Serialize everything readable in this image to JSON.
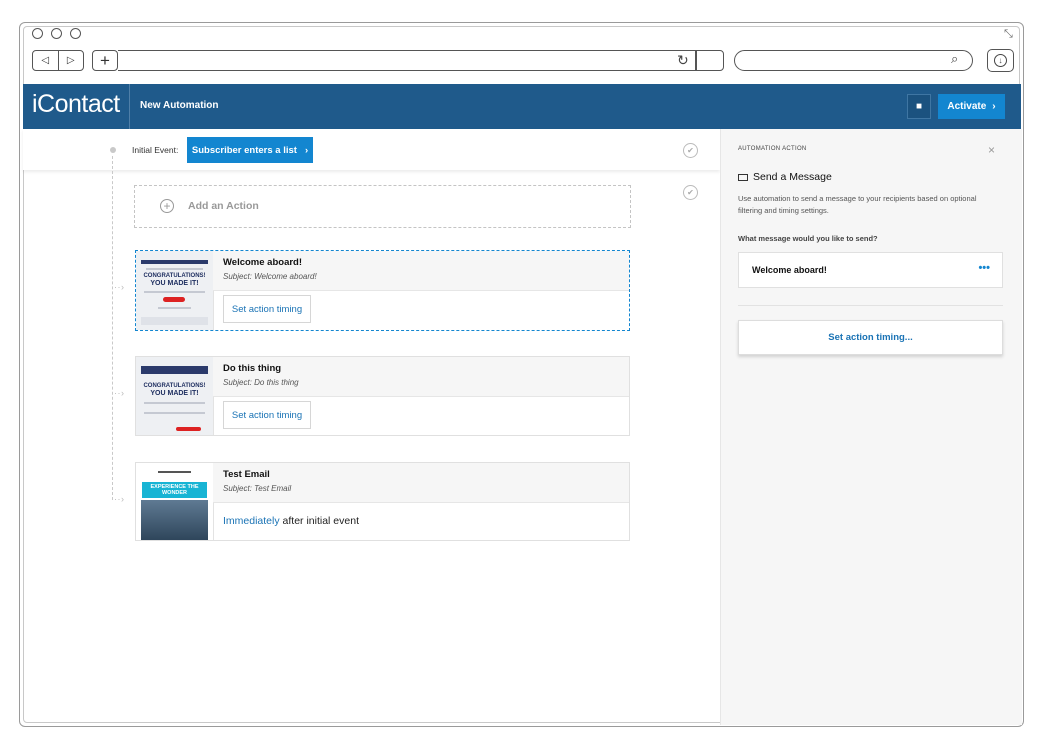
{
  "browser": {
    "back_glyph": "◁",
    "forward_glyph": "▷",
    "new_tab_glyph": "+",
    "reload_glyph": "↻",
    "search_glyph": "⌕",
    "download_glyph": "↓",
    "expand_glyph": "⤡",
    "icons": [
      "back-icon",
      "forward-icon",
      "plus-icon",
      "reload-icon",
      "search-icon",
      "download-icon",
      "expand-icon"
    ]
  },
  "header": {
    "logo": "iContact",
    "title": "New Automation",
    "save_glyph": "■",
    "activate_label": "Activate",
    "activate_chevron": "›",
    "brand_color": "#1f5a8b",
    "accent_color": "#1386d0"
  },
  "workflow": {
    "initial_event_label": "Initial Event:",
    "initial_event_value": "Subscriber enters a list",
    "initial_event_chevron": "›",
    "check_glyph": "✔",
    "connector": "··›",
    "add_action_glyph": "+",
    "add_action_label": "Add an Action",
    "actions": [
      {
        "name": "Welcome aboard!",
        "subject": "Subject: Welcome aboard!",
        "timing_label": "Set action timing",
        "thumb_text_1": "CONGRATULATIONS!",
        "thumb_text_2": "YOU MADE IT!"
      },
      {
        "name": "Do this thing",
        "subject": "Subject: Do this thing",
        "timing_label": "Set action timing",
        "thumb_text_1": "CONGRATULATIONS!",
        "thumb_text_2": "YOU MADE IT!"
      },
      {
        "name": "Test Email",
        "subject": "Subject: Test Email",
        "timing_link": "Immediately",
        "timing_rest": " after initial event",
        "thumb_text_1": "EXPERIENCE THE WONDER"
      }
    ]
  },
  "panel": {
    "kicker": "AUTOMATION ACTION",
    "close_glyph": "×",
    "title": "Send a Message",
    "description": "Use automation to send a message to your recipients based on optional filtering and timing settings.",
    "question": "What message would you like to send?",
    "selected_message": "Welcome aboard!",
    "more_glyph": "•••",
    "timing_button": "Set action timing..."
  }
}
